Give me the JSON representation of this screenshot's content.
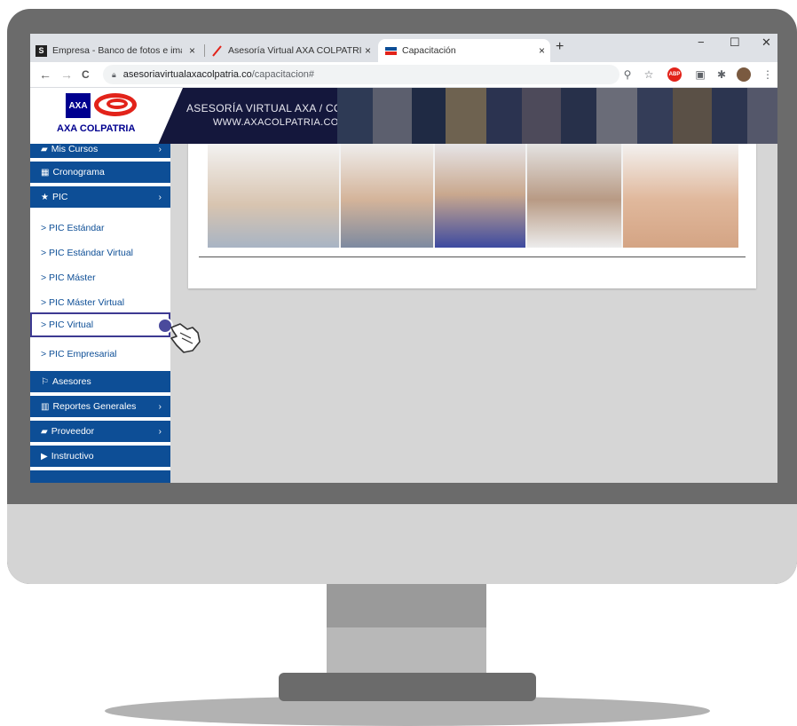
{
  "browser": {
    "tabs": [
      {
        "label": "Empresa - Banco de fotos e imág",
        "close": "×"
      },
      {
        "label": "Asesoría Virtual AXA COLPATRIA",
        "close": "×"
      },
      {
        "label": "Capacitación",
        "close": "×"
      }
    ],
    "new_tab": "+",
    "window_controls": {
      "minimize": "−",
      "maximize": "☐",
      "close": "✕"
    },
    "nav": {
      "back": "←",
      "forward": "→",
      "reload": "C"
    },
    "url_host": "asesoriavirtualaxacolpatria.co",
    "url_path": "/capacitacion#",
    "toolbar_icons": [
      "zoom-icon",
      "star-icon",
      "adblock-icon",
      "cast-icon",
      "extensions-icon",
      "profile-icon",
      "menu-icon"
    ],
    "abp_label": "ABP"
  },
  "banner": {
    "logo_text": "AXA COLPATRIA",
    "logo_mark": "AXA",
    "title_line1": "ASESORÍA VIRTUAL AXA / COLPATRIA",
    "title_line2": "WWW.AXACOLPATRIA.CO"
  },
  "sidebar": {
    "items": [
      {
        "label": "Mis Cursos",
        "icon": "book-icon",
        "chevron": "›"
      },
      {
        "label": "Cronograma",
        "icon": "calendar-icon"
      },
      {
        "label": "PIC",
        "icon": "star-icon",
        "chevron": "›"
      },
      {
        "label": "> PIC Estándar"
      },
      {
        "label": "> PIC Estándar Virtual"
      },
      {
        "label": "> PIC Máster"
      },
      {
        "label": "> PIC Máster Virtual"
      },
      {
        "label": "> PIC Virtual"
      },
      {
        "label": "> PIC Empresarial"
      },
      {
        "label": "Asesores",
        "icon": "flag-icon"
      },
      {
        "label": "Reportes Generales",
        "icon": "chart-icon",
        "chevron": "›"
      },
      {
        "label": "Proveedor",
        "icon": "book-icon",
        "chevron": "›"
      },
      {
        "label": "Instructivo",
        "icon": "play-icon"
      }
    ]
  },
  "colors": {
    "axa_blue": "#00008f",
    "axa_red": "#e2231a",
    "sidebar_blue": "#0d4e96",
    "selected_border": "#3d3a92",
    "banner_bg": "#14173c"
  }
}
